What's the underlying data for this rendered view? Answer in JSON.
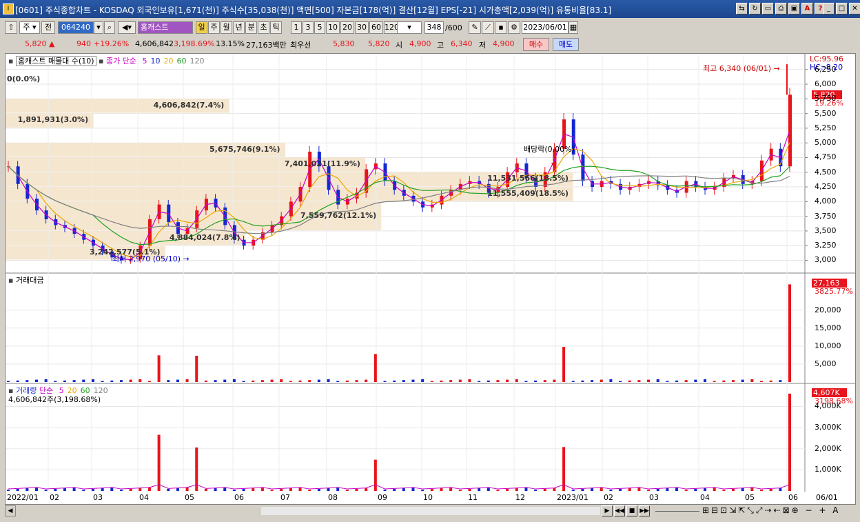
{
  "window": {
    "title": "[0601] 주식종합차트 - KOSDAQ 외국인보유[1,671(천)] 주식수[35,038(천)] 액면[500] 자본금[178(억)] 결산[12월] EPS[-21] 시가총액[2,039(억)] 유통비율[83.1]",
    "icon": "I"
  },
  "toolbar": {
    "market": "주",
    "jeon": "전",
    "code": "064240",
    "name": "홈캐스트",
    "periods": [
      "일",
      "주",
      "월",
      "년",
      "분",
      "초",
      "틱"
    ],
    "intervals": [
      "1",
      "3",
      "5",
      "10",
      "20",
      "30",
      "60",
      "120"
    ],
    "count": "348",
    "count_total": "/600",
    "date": "2023/06/01"
  },
  "quote": {
    "price": "5,820",
    "arrow": "▲",
    "change": "940",
    "change_pct": "+19.26%",
    "volume": "4,606,842",
    "vol_pct": "3,198.69%",
    "turnover": "13.15%",
    "amount": "27,163백만",
    "priority_label": "최우선",
    "ask": "5,830",
    "bid": "5,820",
    "open_label": "시",
    "open": "4,900",
    "high_label": "고",
    "high": "6,340",
    "low_label": "저",
    "low": "4,900",
    "buy": "매수",
    "sell": "매도"
  },
  "panel1": {
    "legend_name": "홈캐스트 매물대 수(10)",
    "ma_label": "종가 단순",
    "ma": [
      "5",
      "10",
      "20",
      "60",
      "120"
    ],
    "lc": "LC:95.96",
    "hc": "HC:-8.20",
    "last_price": "5,820",
    "last_pct": "19.26%",
    "high_note": "최고 6,340 (06/01)",
    "low_note": "최저 2,970 (05/10)",
    "dividend_note": "배당락(0.00%)",
    "yticks": [
      "6,250",
      "6,000",
      "5,750",
      "5,500",
      "5,250",
      "5,000",
      "4,750",
      "4,500",
      "4,250",
      "4,000",
      "3,750",
      "3,500",
      "3,250",
      "3,000"
    ],
    "bands": [
      {
        "label": "0(0.0%)"
      },
      {
        "label": "1,891,931(3.0%)"
      },
      {
        "label": "4,606,842(7.4%)"
      },
      {
        "label": "5,675,746(9.1%)"
      },
      {
        "label": "7,401,021(11.9%)"
      },
      {
        "label": "11,555,409(18.5%)"
      },
      {
        "label": "11,531,566(18.5%)"
      },
      {
        "label": "7,559,762(12.1%)"
      },
      {
        "label": "4,884,024(7.8%)"
      },
      {
        "label": "3,242,577(5.1%)"
      }
    ]
  },
  "panel2": {
    "legend": "거래대금",
    "last": "27,163",
    "last_pct": "3825.77%",
    "yticks": [
      "20,000",
      "15,000",
      "10,000",
      "5,000"
    ]
  },
  "panel3": {
    "legend": "거래량",
    "ma_label": "단순",
    "ma": [
      "5",
      "20",
      "60",
      "120"
    ],
    "sub": "4,606,842주(3,198.68%)",
    "last": "4,607K",
    "last_pct": "3198.68%",
    "yticks": [
      "4,000K",
      "3,000K",
      "2,000K",
      "1,000K"
    ]
  },
  "xaxis": {
    "labels": [
      "2022/01",
      "02",
      "03",
      "04",
      "05",
      "06",
      "07",
      "08",
      "09",
      "10",
      "11",
      "12",
      "2023/01",
      "02",
      "03",
      "04",
      "05",
      "06"
    ],
    "right_label": "06/01"
  },
  "colors": {
    "up": "#e8141c",
    "down": "#1428d0",
    "band": "#f5e6d0",
    "ma5": "#c800c8",
    "ma10": "#1428d0",
    "ma20": "#e8a800",
    "ma60": "#20a020",
    "ma120": "#808080"
  },
  "chart_data": {
    "type": "candlestick",
    "x_period": "daily, 2022/01 - 2023/06/01",
    "price_ylim": [
      2900,
      6400
    ],
    "close_series_approx": [
      4600,
      4300,
      4050,
      3850,
      3700,
      3600,
      3550,
      3450,
      3350,
      3250,
      3150,
      3050,
      3000,
      3020,
      3250,
      3700,
      3950,
      3650,
      3450,
      3550,
      3850,
      4050,
      3900,
      3600,
      3350,
      3250,
      3350,
      3480,
      3600,
      3750,
      4000,
      4250,
      4850,
      4600,
      4200,
      3950,
      4050,
      4150,
      4550,
      4650,
      4350,
      4200,
      4100,
      4000,
      3900,
      3950,
      4100,
      4200,
      4300,
      4350,
      4300,
      4150,
      4250,
      4500,
      4650,
      4400,
      4250,
      4500,
      4900,
      5400,
      4800,
      4350,
      4250,
      4350,
      4300,
      4200,
      4250,
      4300,
      4350,
      4280,
      4200,
      4150,
      4350,
      4250,
      4200,
      4250,
      4400,
      4450,
      4300,
      4350,
      4700,
      4900,
      4600,
      5820
    ],
    "amount_ylim": [
      0,
      28000
    ],
    "volume_ylim": [
      0,
      4700000
    ],
    "last": {
      "close": 5820,
      "amount_mil": 27163,
      "volume": 4606842
    }
  }
}
